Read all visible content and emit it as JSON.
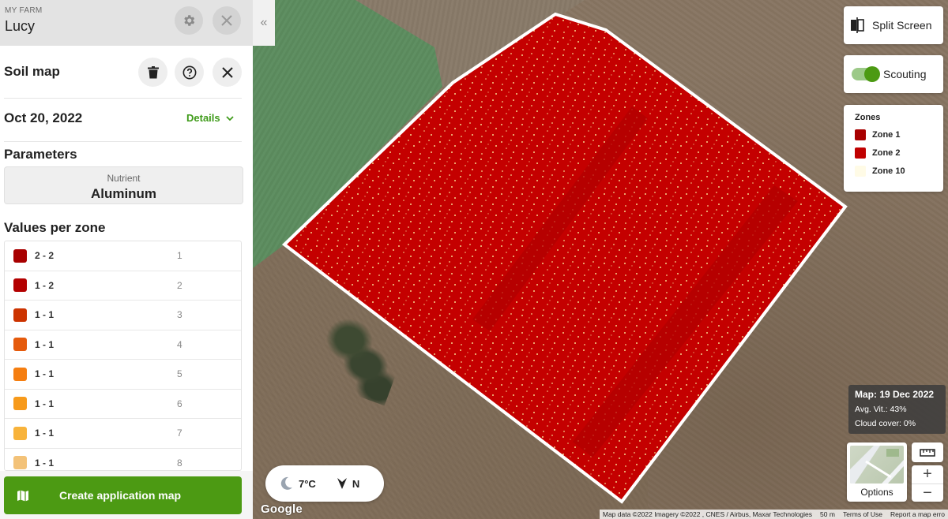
{
  "farm": {
    "label": "MY FARM",
    "name": "Lucy"
  },
  "collapse_glyph": "«",
  "soil_map": {
    "title": "Soil map",
    "date": "Oct 20, 2022",
    "details_label": "Details"
  },
  "parameters": {
    "title": "Parameters",
    "nutrient_label": "Nutrient",
    "nutrient_value": "Aluminum"
  },
  "zones_section": {
    "title": "Values per zone"
  },
  "zones": [
    {
      "range": "2 - 2",
      "zone": "1",
      "color": "#a80000"
    },
    {
      "range": "1 - 2",
      "zone": "2",
      "color": "#b30000"
    },
    {
      "range": "1 - 1",
      "zone": "3",
      "color": "#cc3300"
    },
    {
      "range": "1 - 1",
      "zone": "4",
      "color": "#e55a0c"
    },
    {
      "range": "1 - 1",
      "zone": "5",
      "color": "#f57e10"
    },
    {
      "range": "1 - 1",
      "zone": "6",
      "color": "#f79a1b"
    },
    {
      "range": "1 - 1",
      "zone": "7",
      "color": "#f8b33b"
    },
    {
      "range": "1 - 1",
      "zone": "8",
      "color": "#f3c278"
    }
  ],
  "create_button": {
    "label": "Create application map"
  },
  "map_controls": {
    "split_screen_label": "Split Screen",
    "scouting_label": "Scouting",
    "scouting_on": true,
    "legend": {
      "title": "Zones",
      "items": [
        {
          "label": "Zone 1",
          "color": "#a80000"
        },
        {
          "label": "Zone 2",
          "color": "#c00000"
        },
        {
          "label": "Zone 10",
          "color": "#fffbe6"
        }
      ]
    },
    "map_info": {
      "date": "Map: 19 Dec 2022",
      "avg_vit": "Avg. Vit.: 43%",
      "cloud_cover": "Cloud cover: 0%"
    },
    "options_label": "Options",
    "zoom_in": "+",
    "zoom_out": "−"
  },
  "weather": {
    "temperature": "7°C",
    "wind_direction": "N"
  },
  "map_footer": {
    "google": "Google",
    "attribution": "Map data ©2022 Imagery ©2022 , CNES / Airbus, Maxar Technologies",
    "scale": "50 m",
    "terms": "Terms of Use",
    "report": "Report a map erro"
  },
  "colors": {
    "accent_green": "#4c9a13",
    "field_red": "#c00000"
  }
}
